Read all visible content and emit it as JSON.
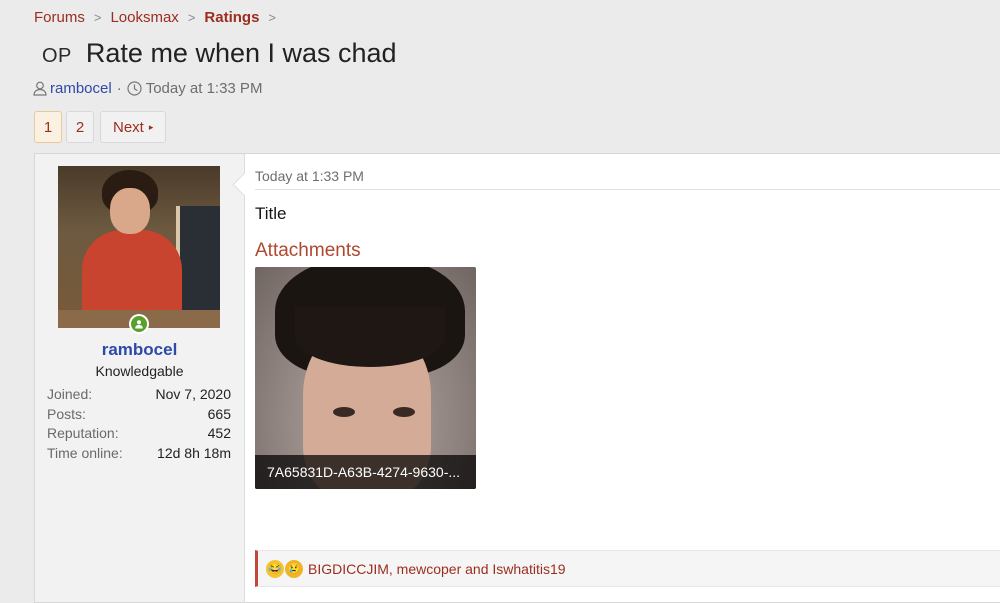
{
  "breadcrumb": {
    "items": [
      "Forums",
      "Looksmax",
      "Ratings"
    ],
    "separator": ">"
  },
  "thread": {
    "prefix": "OP",
    "title": "Rate me when I was chad"
  },
  "meta": {
    "author": "rambocel",
    "separator": "·",
    "time": "Today at 1:33 PM"
  },
  "pagination": {
    "pages": [
      "1",
      "2"
    ],
    "current": "1",
    "next_label": "Next",
    "next_arrow": "▸"
  },
  "post": {
    "user": {
      "name": "rambocel",
      "title": "Knowledgable",
      "status": "online",
      "stats": [
        {
          "label": "Joined:",
          "value": "Nov 7, 2020"
        },
        {
          "label": "Posts:",
          "value": "665"
        },
        {
          "label": "Reputation:",
          "value": "452"
        },
        {
          "label": "Time online:",
          "value": "12d 8h 18m"
        }
      ]
    },
    "date": "Today at 1:33 PM",
    "body": "Title",
    "attachments_heading": "Attachments",
    "attachment_caption": "7A65831D-A63B-4274-9630-...",
    "reactions": {
      "icons": [
        "laugh-cry-icon",
        "sad-icon"
      ],
      "text": "BIGDICCJIM, mewcoper and Iswhatitis19"
    }
  },
  "colors": {
    "link_red": "#9b2e1f",
    "user_blue": "#2e4aa8",
    "online_green": "#5aa02c",
    "reaction_border": "#c4463a"
  }
}
